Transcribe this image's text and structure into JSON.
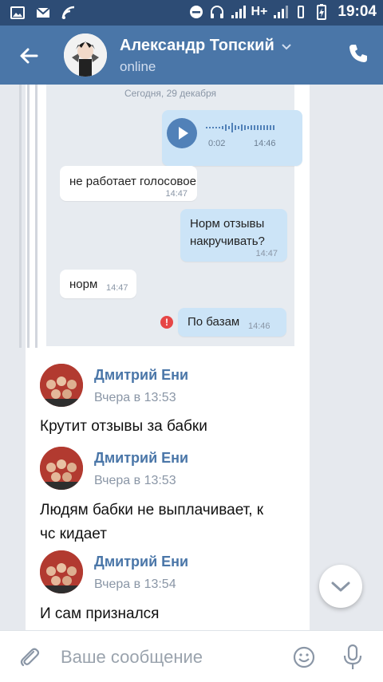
{
  "status_bar": {
    "time": "19:04",
    "network": "H+"
  },
  "header": {
    "title": "Александр Топский",
    "status": "online"
  },
  "embedded_chat": {
    "date": "Сегодня, 29 декабря",
    "voice": {
      "duration": "0:02",
      "time": "14:46"
    },
    "messages": [
      {
        "text": "не работает голосовое",
        "time": "14:47",
        "direction": "in"
      },
      {
        "text_line1": "Норм отзывы",
        "text_line2": "накручивать?",
        "time": "14:47",
        "direction": "out"
      },
      {
        "text": "норм",
        "time": "14:47",
        "direction": "in"
      },
      {
        "text": "По базам",
        "time": "14:46",
        "direction": "out",
        "error": "!"
      }
    ]
  },
  "comments": [
    {
      "author": "Дмитрий Ени",
      "date": "Вчера в 13:53",
      "text": "Крутит отзывы за бабки"
    },
    {
      "author": "Дмитрий Ени",
      "date": "Вчера в 13:53",
      "text_line1": "Людям бабки не выплачивает, к",
      "text_line2": "чс кидает"
    },
    {
      "author": "Дмитрий Ени",
      "date": "Вчера в 13:54",
      "text": "И сам признался"
    }
  ],
  "composer": {
    "placeholder": "Ваше сообщение",
    "value": ""
  },
  "colors": {
    "header": "#4a76a8",
    "status_bar": "#2d4c75",
    "link": "#4a76a8",
    "outgoing_bubble": "#cce4f7",
    "error": "#e64646"
  },
  "icons": [
    "back-arrow-icon",
    "chevron-down-icon",
    "phone-icon",
    "play-icon",
    "error-icon",
    "scroll-down-icon",
    "attach-icon",
    "emoji-icon",
    "mic-icon"
  ]
}
